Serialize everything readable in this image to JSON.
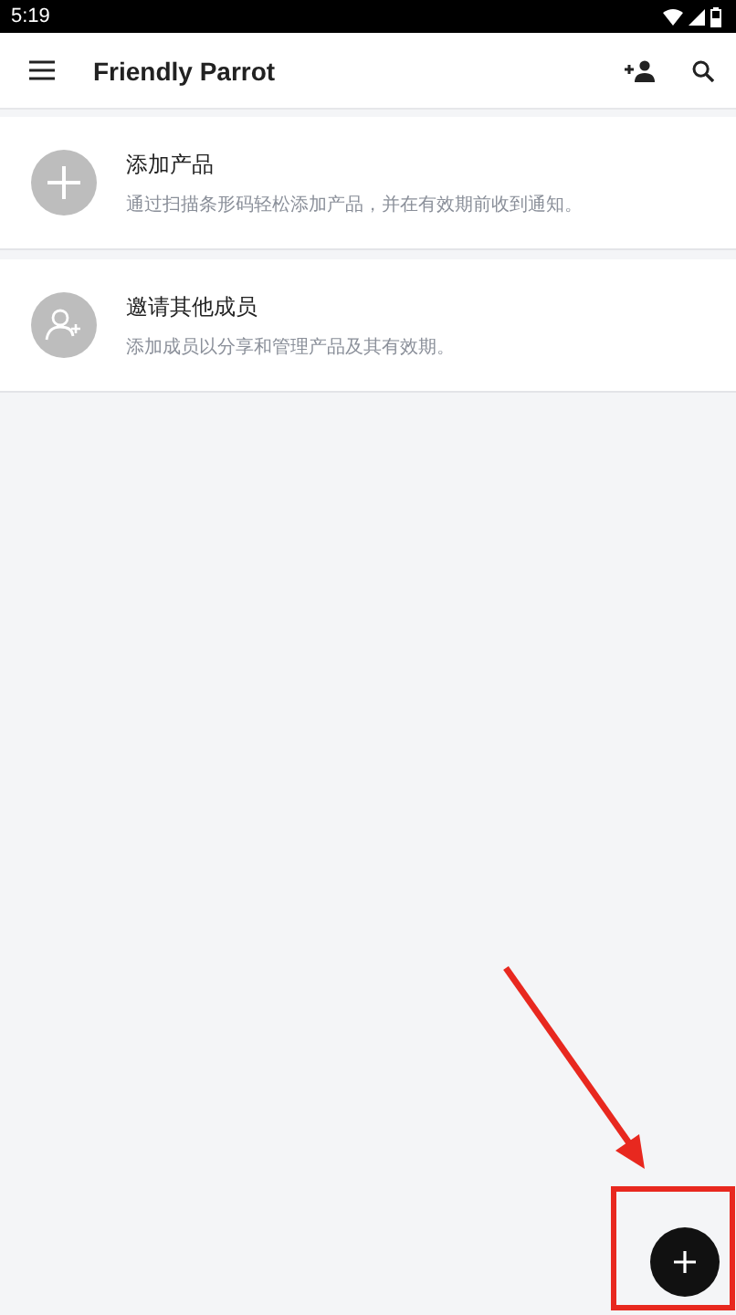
{
  "status_bar": {
    "time": "5:19"
  },
  "app_bar": {
    "title": "Friendly Parrot"
  },
  "cards": [
    {
      "kind": "add",
      "title": "添加产品",
      "subtitle": "通过扫描条形码轻松添加产品，并在有效期前收到通知。"
    },
    {
      "kind": "invite",
      "title": "邀请其他成员",
      "subtitle": "添加成员以分享和管理产品及其有效期。"
    }
  ]
}
